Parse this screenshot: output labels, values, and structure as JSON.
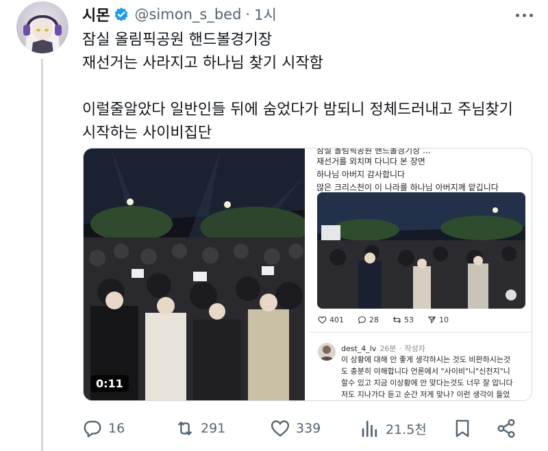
{
  "author": {
    "name": "시몬",
    "handle": "@simon_s_bed",
    "separator": "·",
    "time": "1시"
  },
  "tweet": {
    "text": "잠실 올림픽공원 핸드볼경기장\n재선거는 사라지고 하나님 찾기 시작함\n\n이럴줄알았다 일반인들 뒤에 숨었다가 밤되니 정체드러내고 주님찾기\n시작하는 사이비집단"
  },
  "media": {
    "video": {
      "duration": "0:11"
    },
    "screenshot": {
      "cut_line": "잠실 올림픽공원 핸드볼경기장 ...",
      "text": "재선거를 외치며 다니다 본 장면\n하나님 아버지 감사합니다\n많은 크리스천이 이 나라를 하나님 아버지께 맡깁니다",
      "stats": {
        "likes": "401",
        "replies": "28",
        "reposts": "53",
        "shares": "10"
      },
      "reply": {
        "username": "dest_4_lv",
        "time": "26분",
        "author_tag": "· 작성자",
        "body": "이 상황에 대해 안 좋게 생각하시는 것도 비판하시는것\n도 충분히 이해합니다 언론에서 \"사이비\"니\"신천지\"니\n할수 있고 지금 이상황에 안 맞다는것도 너무 잘 압니다\n저도 지나가다 듣고 순간 저게 맞나? 이런 생각이 들었"
      }
    }
  },
  "actions": {
    "replies": "16",
    "reposts": "291",
    "likes": "339",
    "views": "21.5천"
  },
  "colors": {
    "text": "#0f1419",
    "muted": "#536471",
    "verified": "#1d9bf0",
    "border": "#cfd9de"
  }
}
